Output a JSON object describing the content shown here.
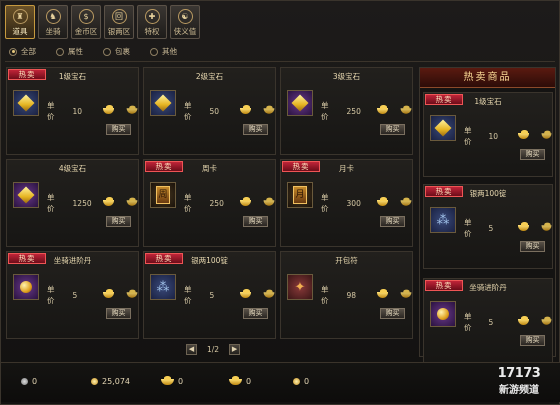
{
  "tabs": [
    {
      "label": "道具",
      "icon": "bag-icon",
      "glyph": "♜",
      "active": true
    },
    {
      "label": "坐骑",
      "icon": "horse-icon",
      "glyph": "♞",
      "active": false
    },
    {
      "label": "金币区",
      "icon": "gold-coin-icon",
      "glyph": "$",
      "active": false
    },
    {
      "label": "银两区",
      "icon": "silver-coin-icon",
      "glyph": "回",
      "active": false
    },
    {
      "label": "特权",
      "icon": "privilege-icon",
      "glyph": "✚",
      "active": false
    },
    {
      "label": "侠义值",
      "icon": "chivalry-icon",
      "glyph": "☯",
      "active": false
    }
  ],
  "filters": [
    {
      "label": "全部",
      "selected": true
    },
    {
      "label": "属性",
      "selected": false
    },
    {
      "label": "包裹",
      "selected": false
    },
    {
      "label": "其他",
      "selected": false
    }
  ],
  "common": {
    "price_label": "单价",
    "buy_label": "购买",
    "hot_tag": "热卖"
  },
  "items": [
    {
      "name": "1级宝石",
      "hot": true,
      "price": "10",
      "icon": "yellow-gem-icon",
      "kind": "gem",
      "bg": ""
    },
    {
      "name": "2级宝石",
      "hot": false,
      "price": "50",
      "icon": "yellow-gem-icon",
      "kind": "gem",
      "bg": ""
    },
    {
      "name": "3级宝石",
      "hot": false,
      "price": "250",
      "icon": "yellow-gem-icon",
      "kind": "gem",
      "bg": "purple"
    },
    {
      "name": "4级宝石",
      "hot": false,
      "price": "1250",
      "icon": "yellow-gem-icon",
      "kind": "gem",
      "bg": "purple"
    },
    {
      "name": "周卡",
      "hot": true,
      "price": "250",
      "icon": "week-card-icon",
      "kind": "card",
      "glyph": "周",
      "bg": "dark"
    },
    {
      "name": "月卡",
      "hot": true,
      "price": "300",
      "icon": "month-card-icon",
      "kind": "card",
      "glyph": "月",
      "bg": "dark"
    },
    {
      "name": "坐骑进阶丹",
      "hot": true,
      "price": "5",
      "icon": "mount-pill-icon",
      "kind": "pill",
      "bg": "purple"
    },
    {
      "name": "银两100锭",
      "hot": true,
      "price": "5",
      "icon": "silver-ingot-icon",
      "kind": "silver",
      "bg": ""
    },
    {
      "name": "开包符",
      "hot": false,
      "price": "98",
      "icon": "bag-unlock-icon",
      "kind": "chest",
      "bg": "red"
    }
  ],
  "pager": {
    "text": "1/2",
    "prev": "◀",
    "next": "▶"
  },
  "hot_panel": {
    "title": "热卖商品",
    "items": [
      {
        "name": "1级宝石",
        "price": "10",
        "icon": "yellow-gem-icon",
        "kind": "gem",
        "bg": ""
      },
      {
        "name": "银两100锭",
        "price": "5",
        "icon": "silver-ingot-icon",
        "kind": "silver",
        "bg": ""
      },
      {
        "name": "坐骑进阶丹",
        "price": "5",
        "icon": "mount-pill-icon",
        "kind": "pill",
        "bg": "purple"
      }
    ]
  },
  "currencies": [
    {
      "value": "0",
      "icon": "silver-coin-icon",
      "kind": "coin-grey"
    },
    {
      "value": "25,074",
      "icon": "gold-coin-icon",
      "kind": "coin"
    },
    {
      "value": "0",
      "icon": "gold-ingot-icon",
      "kind": "ingot"
    },
    {
      "value": "0",
      "icon": "gold-ingot-icon",
      "kind": "ingot"
    },
    {
      "value": "0",
      "icon": "gold-coin-icon",
      "kind": "coin"
    }
  ],
  "watermark": {
    "logo": "17173",
    "sub": "新游频道"
  }
}
